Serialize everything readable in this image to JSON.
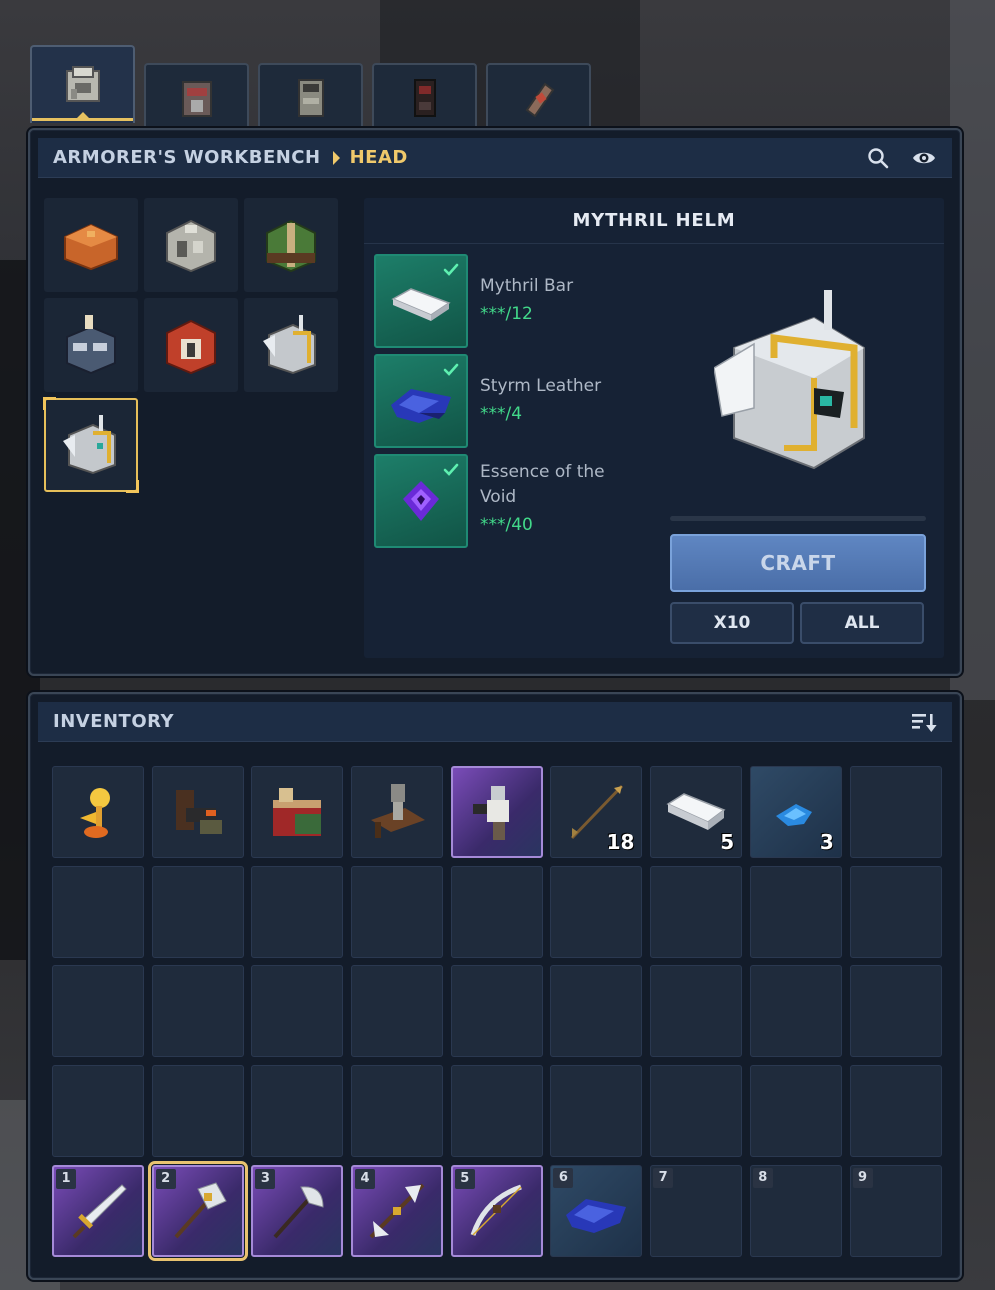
{
  "tabs": [
    {
      "icon": "iron-helm-tab-icon",
      "active": true
    },
    {
      "icon": "reinforced-chest-tab-icon",
      "active": false
    },
    {
      "icon": "stone-armor-tab-icon",
      "active": false
    },
    {
      "icon": "dark-armor-tab-icon",
      "active": false
    },
    {
      "icon": "bracer-tab-icon",
      "active": false
    }
  ],
  "workbench": {
    "title": "ARMORER'S WORKBENCH",
    "category": "HEAD",
    "search_icon": "search-icon",
    "visibility_icon": "eye-icon"
  },
  "recipes": [
    {
      "icon": "copper-helm-icon"
    },
    {
      "icon": "iron-helm-icon"
    },
    {
      "icon": "leather-helm-icon"
    },
    {
      "icon": "plumed-cobalt-helm-icon"
    },
    {
      "icon": "red-adamantite-helm-icon"
    },
    {
      "icon": "winged-thorium-helm-icon"
    },
    {
      "icon": "mythril-helm-icon",
      "selected": true
    }
  ],
  "detail": {
    "title": "MYTHRIL HELM",
    "ingredients": [
      {
        "name": "Mythril Bar",
        "count": "***/12",
        "icon": "mythril-bar-icon"
      },
      {
        "name": "Styrm Leather",
        "count": "***/4",
        "icon": "styrm-leather-icon"
      },
      {
        "name": "Essence of the Void",
        "count": "***/40",
        "icon": "void-essence-icon"
      }
    ],
    "craft_label": "CRAFT",
    "x10_label": "X10",
    "all_label": "ALL",
    "progress": 0
  },
  "inventory": {
    "title": "INVENTORY",
    "sort_icon": "sort-icon",
    "slots_row1": [
      {
        "icon": "golden-flower-icon",
        "qty": ""
      },
      {
        "icon": "anvil-bench-icon",
        "qty": ""
      },
      {
        "icon": "crafting-table-icon",
        "qty": ""
      },
      {
        "icon": "armor-stand-bench-icon",
        "qty": ""
      },
      {
        "icon": "knight-figure-icon",
        "qty": "",
        "rarity": "epic"
      },
      {
        "icon": "arrow-icon",
        "qty": "18"
      },
      {
        "icon": "mythril-bar-icon",
        "qty": "5"
      },
      {
        "icon": "blue-crystal-icon",
        "qty": "3"
      },
      {
        "icon": "",
        "qty": ""
      }
    ],
    "hotbar": [
      {
        "key": "1",
        "icon": "sword-icon",
        "rarity": "epic"
      },
      {
        "key": "2",
        "icon": "warhammer-icon",
        "rarity": "epic",
        "selected": true
      },
      {
        "key": "3",
        "icon": "battle-axe-icon",
        "rarity": "epic"
      },
      {
        "key": "4",
        "icon": "double-blade-icon",
        "rarity": "epic"
      },
      {
        "key": "5",
        "icon": "bow-icon",
        "rarity": "epic"
      },
      {
        "key": "6",
        "icon": "styrm-leather-icon",
        "rarity": "rare"
      },
      {
        "key": "7",
        "icon": ""
      },
      {
        "key": "8",
        "icon": ""
      },
      {
        "key": "9",
        "icon": ""
      }
    ]
  },
  "colors": {
    "accent_gold": "#f0c96b",
    "ok_green": "#42d98a",
    "epic_purple": "#7a4cb8",
    "craft_blue": "#5f86c2"
  }
}
